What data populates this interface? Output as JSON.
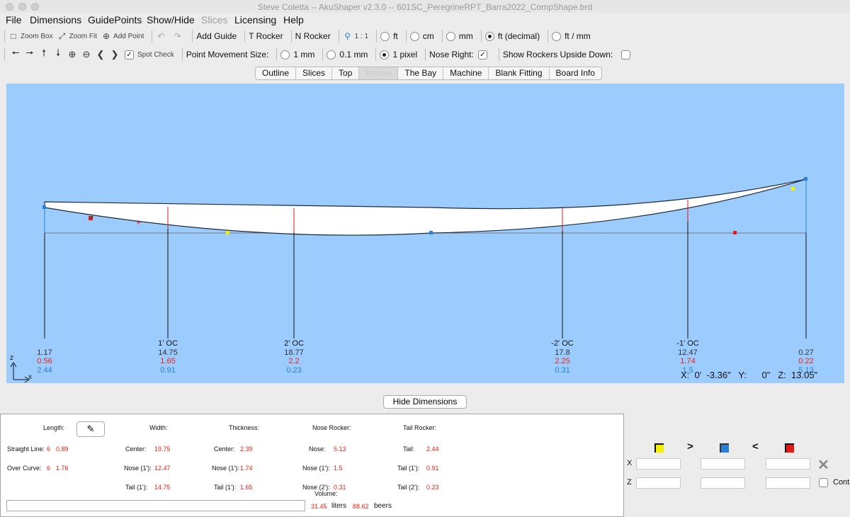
{
  "window": {
    "title": "Steve Coletta -- AkuShaper v2.3.0  --  601SC_PeregrineRPT_Barra2022_CompShape.brd"
  },
  "menu": [
    "File",
    "Dimensions",
    "GuidePoints",
    "Show/Hide",
    "Slices",
    "Licensing",
    "Help"
  ],
  "toolbar1": {
    "zoom_box": "Zoom Box",
    "zoom_fit": "Zoom Fit",
    "add_point": "Add Point",
    "add_guide": "Add Guide",
    "t_rocker": "T Rocker",
    "n_rocker": "N Rocker",
    "scale": "1 : 1",
    "units": [
      "ft",
      "cm",
      "mm",
      "ft (decimal)",
      "ft / mm"
    ],
    "units_selected": "ft (decimal)"
  },
  "toolbar2": {
    "spot_check": "Spot Check",
    "point_movement_label": "Point Movement Size:",
    "movement_options": [
      "1 mm",
      "0.1 mm",
      "1 pixel"
    ],
    "movement_selected": "1 pixel",
    "nose_right_label": "Nose Right:",
    "nose_right_checked": true,
    "show_rockers_label": "Show Rockers Upside Down:",
    "show_rockers_checked": false
  },
  "tabs": [
    "Outline",
    "Slices",
    "Top",
    "Bottom",
    "The Bay",
    "Machine",
    "Blank Fitting",
    "Board Info"
  ],
  "active_tab": "Bottom",
  "canvas": {
    "colors": {
      "background": "#9ccbfe",
      "board": "#ffffff",
      "guide": "#e21a1a",
      "yellow": "#f5f000",
      "blue": "#2a80d6",
      "red": "#e21a1a"
    },
    "axis_z": "z",
    "axis_x": "x",
    "dimension_columns": [
      {
        "label": "",
        "v1": "1.17",
        "v2": "0.56",
        "v3": "2.44"
      },
      {
        "label": "1' OC",
        "v1": "14.75",
        "v2": "1.65",
        "v3": "0.91"
      },
      {
        "label": "2' OC",
        "v1": "18.77",
        "v2": "2.2",
        "v3": "0.23"
      },
      {
        "label": "-2' OC",
        "v1": "17.8",
        "v2": "2.25",
        "v3": "0.31"
      },
      {
        "label": "-1' OC",
        "v1": "12.47",
        "v2": "1.74",
        "v3": "1.5"
      },
      {
        "label": "",
        "v1": "0.27",
        "v2": "0.22",
        "v3": "5.13"
      }
    ],
    "coords": {
      "x": "X:  0'  -3.36\"",
      "y": "Y:      0\"",
      "z": "Z:  13.05\""
    }
  },
  "hide_dimensions": "Hide Dimensions",
  "panel": {
    "length_label": "Length:",
    "width_label": "Width:",
    "thickness_label": "Thickness:",
    "nose_rocker_label": "Nose Rocker:",
    "tail_rocker_label": "Tail Rocker:",
    "straight_line_label": "Straight Line:",
    "straight_line_ft": "6",
    "straight_line_in": "0.89",
    "over_curve_label": "Over Curve:",
    "over_curve_ft": "6",
    "over_curve_in": "1.76",
    "width_center_label": "Center:",
    "width_center": "19.75",
    "width_nose_label": "Nose (1'):",
    "width_nose": "12.47",
    "width_tail_label": "Tail (1'):",
    "width_tail": "14.75",
    "thick_center_label": "Center:",
    "thick_center": "2.39",
    "thick_nose_label": "Nose (1'):",
    "thick_nose": "1.74",
    "thick_tail_label": "Tail (1'):",
    "thick_tail": "1.65",
    "nose_label": "Nose:",
    "nose": "5.13",
    "nose1_label": "Nose (1'):",
    "nose1": "1.5",
    "nose2_label": "Nose (2'):",
    "nose2": "0.31",
    "tail_label": "Tail:",
    "tail": "2.44",
    "tail1_label": "Tail (1'):",
    "tail1": "0.91",
    "tail2_label": "Tail (2'):",
    "tail2": "0.23",
    "volume_label": "Volume:",
    "liters": "31.45",
    "liters_label": "liters",
    "beers": "88.62",
    "beers_label": "beers"
  },
  "control_points": {
    "x_label": "X",
    "z_label": "Z",
    "cont_label": "Cont",
    "swatch_colors": [
      "#f5f000",
      "#2a80d6",
      "#e21a1a"
    ]
  }
}
